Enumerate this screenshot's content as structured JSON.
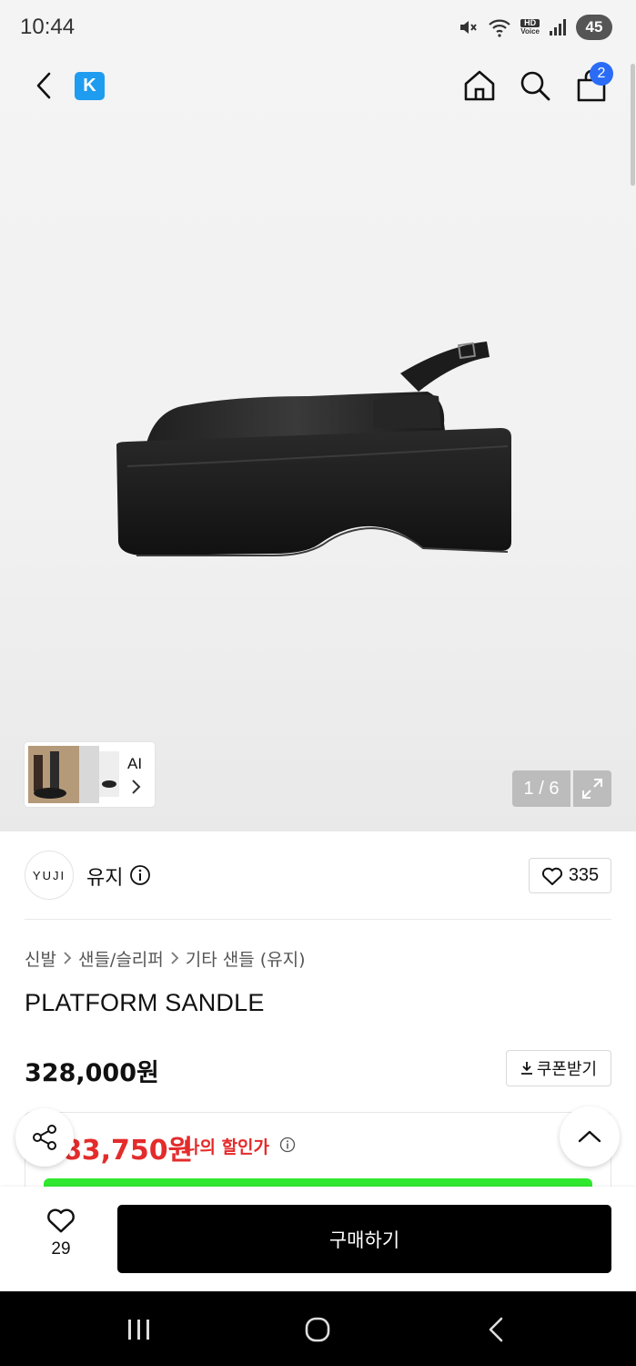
{
  "status_bar": {
    "time": "10:44",
    "battery": "45",
    "hd": "HD",
    "voice": "Voice"
  },
  "header": {
    "badge_letter": "K",
    "cart_count": "2"
  },
  "gallery": {
    "ai_label": "AI",
    "page_indicator": "1 / 6"
  },
  "brand": {
    "logo_text": "YUJI",
    "name": "유지",
    "like_count": "335"
  },
  "breadcrumb": [
    "신발",
    "샌들/슬리퍼",
    "기타 샌들 (유지)"
  ],
  "product": {
    "title": "PLATFORM SANDLE",
    "price": "328,000원",
    "coupon_label": "쿠폰받기",
    "discount_price": "283,750원",
    "discount_label": "나의 할인가"
  },
  "purchase_bar": {
    "wish_count": "29",
    "buy_label": "구매하기"
  },
  "colors": {
    "accent_blue": "#2a6cf6",
    "kakao_blue": "#1e9cf0",
    "discount_red": "#e42b2b",
    "green_bar": "#2fe82f",
    "buy_button": "#000000"
  }
}
